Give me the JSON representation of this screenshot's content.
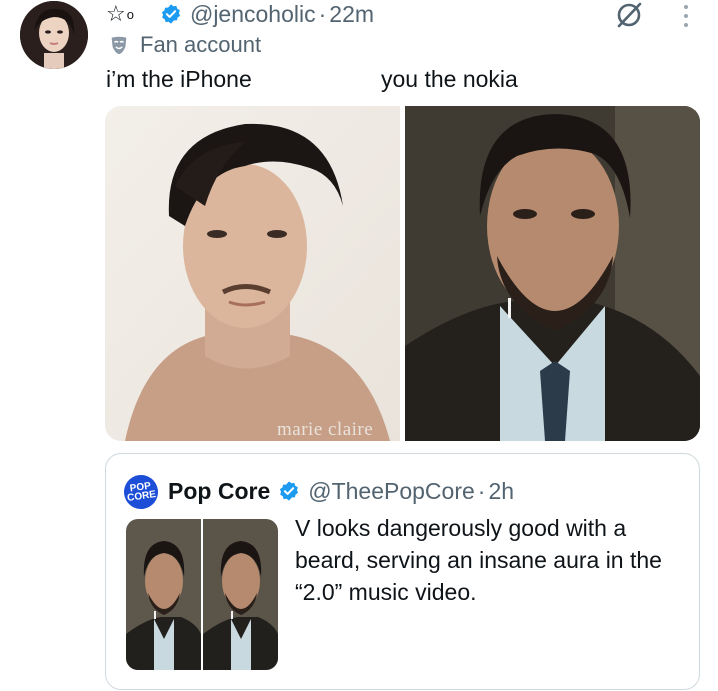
{
  "tweet": {
    "author_handle": "@jencoholic",
    "separator": "·",
    "timestamp": "22m",
    "name_symbols": "☆",
    "name_circle": "o",
    "label": "Fan account",
    "text_left": "i’m the iPhone",
    "text_right": "you the nokia",
    "watermark": "marie claire"
  },
  "quoted_tweet": {
    "avatar_text_top": "POP",
    "avatar_text_bottom": "CORE",
    "name": "Pop Core",
    "handle": "@TheePopCore",
    "separator": "·",
    "timestamp": "2h",
    "text": "V looks dangerously good with a beard, serving an insane aura in the “2.0” music video."
  },
  "colors": {
    "verified": "#1d9bf0",
    "secondary_text": "#536471",
    "border": "#cfd9de"
  }
}
